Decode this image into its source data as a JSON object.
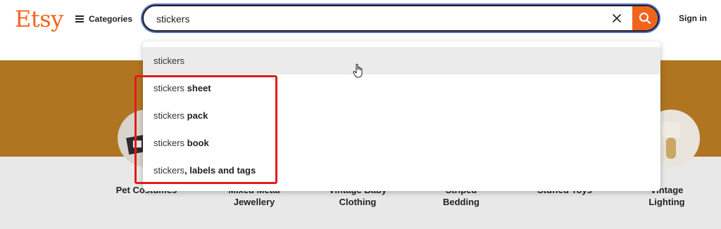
{
  "header": {
    "logo": "Etsy",
    "categories_label": "Categories",
    "search_value": "stickers",
    "signin_label": "Sign in"
  },
  "colors": {
    "brand": "#f1641e",
    "focus_ring": "#4d6bc6",
    "highlight": "#e21b1b",
    "banner": "#b07520"
  },
  "suggestions": [
    {
      "prefix": "stickers",
      "suffix": ""
    },
    {
      "prefix": "stickers",
      "suffix": " sheet"
    },
    {
      "prefix": "stickers",
      "suffix": " pack"
    },
    {
      "prefix": "stickers",
      "suffix": " book"
    },
    {
      "prefix": "stickers",
      "suffix": ", labels and tags"
    }
  ],
  "categories": [
    {
      "line1": "Pet Costumes",
      "line2": ""
    },
    {
      "line1": "Mixed Metal",
      "line2": "Jewellery"
    },
    {
      "line1": "Vintage Baby",
      "line2": "Clothing"
    },
    {
      "line1": "Striped",
      "line2": "Bedding"
    },
    {
      "line1": "Stuffed Toys",
      "line2": ""
    },
    {
      "line1": "Vintage",
      "line2": "Lighting"
    }
  ],
  "icons": {
    "menu": "menu-icon",
    "clear": "close-icon",
    "search": "search-icon",
    "cursor": "hand-pointer-icon"
  }
}
